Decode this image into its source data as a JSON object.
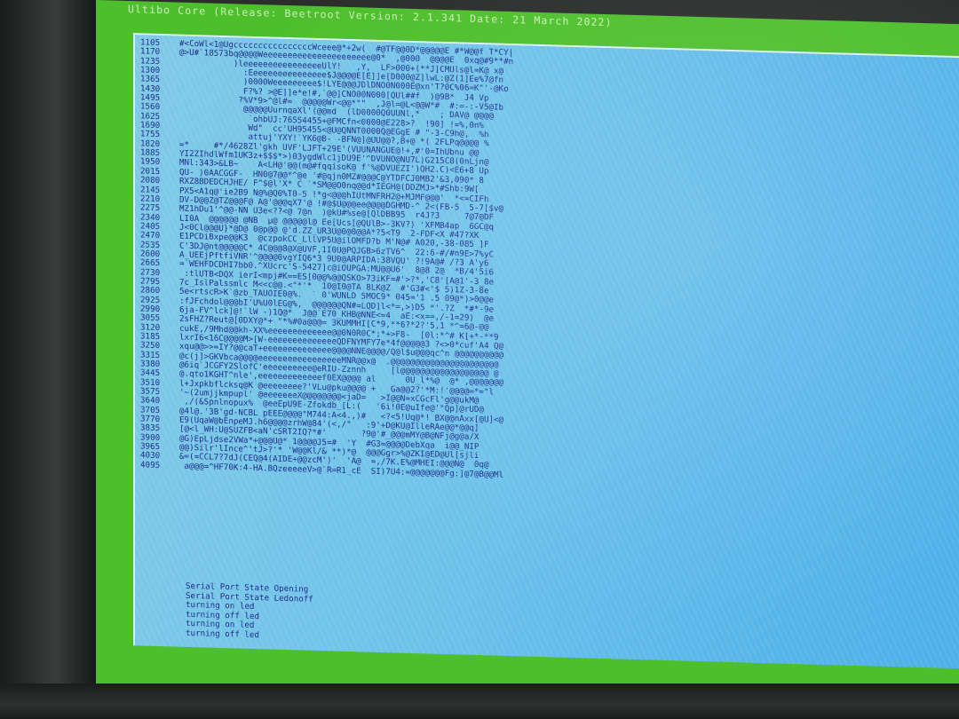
{
  "header": {
    "title": "Ultibo Core (Release: Beetroot Version: 2.1.341 Date: 21 March 2022)"
  },
  "console": {
    "lines": [
      {
        "num": "1105",
        "text": "#<CoWl<1@UgccccccccccccccccWceee@*+2w(  #@TF@@0D*@@@@@E #*W@@f T*CY|"
      },
      {
        "num": "1170",
        "text": "@>U#`18573bq@@@@Weeeeeeeeeeeeeeeeeeeeee@0*  ,@000  @@@@E  0xq@#9**#n"
      },
      {
        "num": "1235",
        "text": "           )leeeeeeeeeeeeeeeeUlY!   ,Y,  LF>000+(**J]CMUls@l=K@ x@"
      },
      {
        "num": "1300",
        "text": "             :Eeeeeeeeeeeeeeee$J@@@@E[E]]e[D000@Z]lwL:@Z(1]Ee%7@fn"
      },
      {
        "num": "1365",
        "text": "             )0000Weeeeeeeee$!LYE@@@JDlDNO0N000E@xn'T?0C%06=K\"'-@Ko"
      },
      {
        "num": "1430",
        "text": "             F?%? >@E]]e*e!#,`@@]CNO00N000[QUl##f  )@9B*  J4 Vp"
      },
      {
        "num": "1495",
        "text": "            ?%V*9>^@l#=  @@@@@Wr<@@*\"\"  ,J@l=@L<@@W*#  #:=-:-V5@Ib"
      },
      {
        "num": "1560",
        "text": "             @@@@@UurnqaXl'(@@md  (lD0000Q0UUNl,*    ; DAV@ @@@@"
      },
      {
        "num": "1625",
        "text": "              `ohbUJ:76554455+@FMCfn<0000@E228>?  !90] !=%,0n%"
      },
      {
        "num": "1690",
        "text": "              Wd\"  cc'UH95455<@U@QNNT0000Q@EGgE # \"-3-C9h@,  %h"
      },
      {
        "num": "1755",
        "text": "              attuj'YXY!`YK6@B- -BFN@]@UU@@?,B+@ *( 2FLPq@@@@ %"
      },
      {
        "num": "1820",
        "text": "=*     #*/4628Zl'gkh UVF'LJFT+29E'(VUUNANGUE@!+,#'0=IhUbnu @@"
      },
      {
        "num": "1885",
        "text": "YI2ZIhdlWfm1UK3z+$$$*>)03ygdWlc1jDU9E'^DVUNO@NU7L)G215C8(0nLjn@"
      },
      {
        "num": "1950",
        "text": "MNl:343>&LB~    A<LH@'@@(m@#fqqisoK@ f'%@DVUEZI')QH2.C)<E6+8 Up"
      },
      {
        "num": "2015",
        "text": "QU- )0AACGGF-  HN0@7@@*^@e '#@qjn0MZ#@@@C@YTDFCJ0MB2'&3,090* 8"
      },
      {
        "num": "2080",
        "text": "RXZ8BDEDCHJHE/ F^$@l'X* C `*SM@@O0nq@@d*IEGH@(DDZMJ>*#Shb:9W["
      },
      {
        "num": "2145",
        "text": "PX5<A1q@'ie2B9 N@%@Q0%T0-5 !*g<@@@hIUtMNFRH2@+MJMF@@@'  *<=CIFh"
      },
      {
        "num": "2210",
        "text": "DV-D@@Z@TZ@@@F@ A@'@@@qX7'@ !#@$U@@@ee@@@@DGHMD-^ 2<(FB-5  5-7[$v@"
      },
      {
        "num": "2275",
        "text": "MZ1hDu1'^@@-NN U3e<??<@ 7@n  )@kU#%se@[QlDBB95  r4J?3     7@7@DF"
      },
      {
        "num": "2340",
        "text": "LI0A  @@@@@@ @NB  µ@ @@@@@l@ Ee[Ucs[@QUlB>-3KV?) 'XFMB4ap  6GC@q"
      },
      {
        "num": "2405",
        "text": "J<0Cl@@@U}*@D@ 0@p@@ @'d.ZZ_UR3U@0@0@@A*?5<T9  2-FDF<X #47?XK"
      },
      {
        "num": "2470",
        "text": "E1PCDiBxpe@@K3  @czpokCC_LllVP5U@ilOMFD?b M'N@# A020,-38-085 ]F"
      },
      {
        "num": "2535",
        "text": "C'3DJ@nt@@@@@C* 4C@@@8@X@UVF,1I0U@PQJGB>6zTV6^  22:6-#/#n9E>7%yC"
      },
      {
        "num": "2600",
        "text": "A_UEEjPftfiVNR'^@@@@0vgYIQ6*3 9U0@ARPIDA:38VQU' ?!9A@# /?3 A'y6"
      },
      {
        "num": "2665",
        "text": "=`WEHFDCDHI7bb0.^XUcrc'S-5427]c@iOUPGA:MU@@U6'  8@8 2@  *B/4'5i6"
      },
      {
        "num": "2730",
        "text": " :tlUTB<DQX ierI<mpj#K==ES[0@@%@@QSKO>73iKF=#'>?*,'C8'[A@1'-3_8e"
      },
      {
        "num": "2795",
        "text": "7c_IslPalssmlc M<<c@@.<\"*'*  10@I0@TA 8LK@Z  #'G3#<'$ 5)1Z-3-8e"
      },
      {
        "num": "2860",
        "text": "5e<rtscR>K`@zb_TAUOIE0@%.  ` 0'WUNLD 5MOC9* 045='1 .5 09@*)>0@@e"
      },
      {
        "num": "2925",
        "text": ":fJFchdol@@@bI'U%U0lEG@%,  @@@@@@QN#=LQD]l<*=,>)D5 *'.?Z  *#*-9e"
      },
      {
        "num": "2990",
        "text": "6ja-FV^lck]@!`lW -)1Q@*  J@@`E70_KHB@NNE<=4  aE:<x==,/-1=29)  @e"
      },
      {
        "num": "3055",
        "text": "2sFHZ?Reut@[0DXY@*+ \"*%#0a@@@= 3KUMMHI[C*9,**6?*2?'5,1 *^=6@-@@"
      },
      {
        "num": "3120",
        "text": "cukE,/9Mhd@@kh-XX%eeeeeeeeeeeee@@0N0R0C*;*+>F8-  [0l:*^# K[+*-**9"
      },
      {
        "num": "3185",
        "text": "lxrI6<16C@@@@M>[W-eeeeeeeeeeeeeeQDFNYMFY7e*4f@@@@@3 ?<>0*cuf'A4 Q@"
      },
      {
        "num": "3250",
        "text": "xqu@@>>=IY?@@caT+eeeeeeeeeeeeee@@@@NNE@@@@/Q@l$u@@@qc^n @@@@@@@@@@"
      },
      {
        "num": "3315",
        "text": "@c(j]>GKVbca@@@@eeeeeeeeeeeeeeeeeMNR@@x@  .@@@@@@@@@@@@@@@@@@@@@@"
      },
      {
        "num": "3380",
        "text": "@6iq`JCGFY2SlofC'eeeeeeeeee@eRIU-Zznnh     [l@@@@@@@@@@@@@@@@@@ @"
      },
      {
        "num": "3445",
        "text": "@.qto1KGHT^nle',eeeeeeeeeeeeef0EX@@@@ al      0U_l*%@  @* ,@@@@@@@"
      },
      {
        "num": "3510",
        "text": "l+Jxpkbflcksq@K @eeeeeeee?'VLu@pku@@@@ +   Ga@@2?'*M:!'@@@@=*=\"l"
      },
      {
        "num": "3575",
        "text": "'~(2umjjkmpupl' @eeeeeeeX@@@@@@@@<jaD=   >I@@N=xCGcFl'g@@ukM@"
      },
      {
        "num": "3640",
        "text": " ,/(&Spnlnopux%  @eeEpU9E-Zfokdb_[L:(   '6i!0E@uIfe@'\"Qp]@rUD@"
      },
      {
        "num": "3705",
        "text": "@4l@.'3B'gd-NCBL pEEE@@@@\"M744:A<4.,)#   <?<5!Uq@*! BX@@nAxx[@U]<@"
      },
      {
        "num": "3770",
        "text": "E9(UqaW@bEnpeMJ.h6@@@@zrhW@84'(<,/\"   :9'+D@KU@IlleRAe@@*@@q]"
      },
      {
        "num": "3835",
        "text": "[@<l_WH:U@SUZFB<aN'cSRT2IQ?*#'       ?9@'#_@@@mMY@B@NFj@g@a/X"
      },
      {
        "num": "3900",
        "text": "@G)EpLjdse2VWa*+@@@U@* 1@@@@J5=#  'Y  #G3=@@@@DebXqa  i@@_NIP"
      },
      {
        "num": "3965",
        "text": "@@)Silr'lInce^'tJ>?'* 'W@@Kl/& **)*@  @@@Ggr>%@ZKI@ED@Ul[sjli"
      },
      {
        "num": "4030",
        "text": "&=(=CCL7?7dJ(CEQ@4(AIDE+@@zcM')'  'A@  =,/7K.E%@MHEI:@@@N@  0q@"
      },
      {
        "num": "4095",
        "text": " a@@@=^HF70K:4-HA.BQzeeeeeV>@`R=R1_cE  SI)7U4:=@@@@@@@Fg:]@7@B@@Ml"
      }
    ],
    "status": [
      "Serial Port State Opening",
      "Serial Port State Ledonoff",
      "turning on led",
      "turning off led",
      "turning on led",
      "turning off led"
    ]
  },
  "colors": {
    "border_green": "#4ebf2c",
    "console_blue": "#6fc3ea",
    "text_navy": "#1a2a88"
  }
}
